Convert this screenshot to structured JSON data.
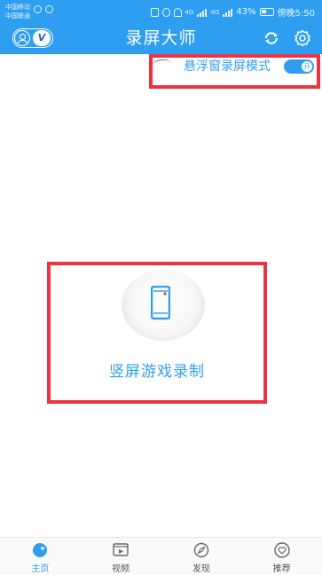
{
  "status_bar": {
    "carrier_1": "中国移动",
    "carrier_2": "中国联通",
    "network_1": "4G",
    "network_2": "4G",
    "battery": "43%",
    "time": "傍晚5:50"
  },
  "header": {
    "title": "录屏大师",
    "vip_label": "V"
  },
  "float_mode": {
    "label": "悬浮窗录屏模式",
    "toggle_label": "开",
    "enabled": true
  },
  "main": {
    "record_label": "竖屏游戏录制"
  },
  "bottom_nav": {
    "items": [
      {
        "label": "主页",
        "active": true
      },
      {
        "label": "视频",
        "active": false
      },
      {
        "label": "发现",
        "active": false
      },
      {
        "label": "推荐",
        "active": false
      }
    ]
  },
  "colors": {
    "primary": "#2e9ff0",
    "highlight": "#ee3340"
  },
  "icons": {
    "user": "user-icon",
    "refresh": "refresh-icon",
    "settings": "gear-icon",
    "record_device": "phone-icon",
    "nav_home": "home-icon",
    "nav_video": "video-icon",
    "nav_discover": "compass-icon",
    "nav_recommend": "heart-icon"
  }
}
